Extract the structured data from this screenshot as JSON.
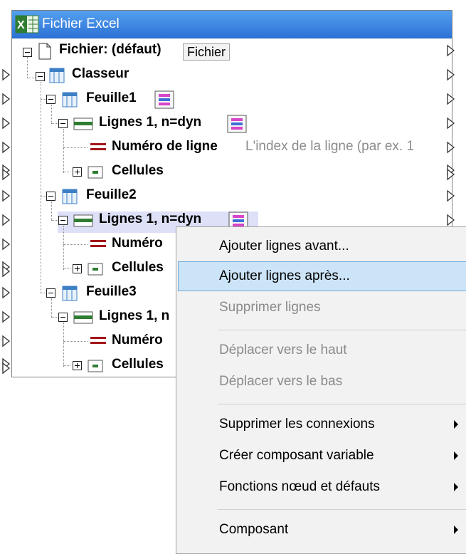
{
  "component": {
    "title": "Fichier Excel",
    "file_label": "Fichier: (défaut)",
    "file_button": "Fichier",
    "nodes": {
      "workbook": "Classeur",
      "sheet1": "Feuille1",
      "rows1": "Lignes 1, n=dyn",
      "rownum1": "Numéro de ligne",
      "rownum1_desc": "L'index de la ligne (par ex. 1",
      "cells1": "Cellules",
      "sheet2": "Feuille2",
      "rows2": "Lignes 1, n=dyn",
      "rownum2": "Numéro",
      "cells2": "Cellules",
      "sheet3": "Feuille3",
      "rows3": "Lignes 1, n",
      "rownum3": "Numéro",
      "cells3": "Cellules"
    }
  },
  "context_menu": {
    "items": [
      {
        "label": "Ajouter lignes avant...",
        "enabled": true
      },
      {
        "label": "Ajouter lignes après...",
        "enabled": true,
        "highlighted": true
      },
      {
        "label": "Supprimer lignes",
        "enabled": false
      },
      {
        "label": "Déplacer vers le haut",
        "enabled": false
      },
      {
        "label": "Déplacer vers le bas",
        "enabled": false
      },
      {
        "label": "Supprimer les connexions",
        "enabled": true,
        "submenu": true
      },
      {
        "label": "Créer composant variable",
        "enabled": true,
        "submenu": true
      },
      {
        "label": "Fonctions nœud et défauts",
        "enabled": true,
        "submenu": true
      },
      {
        "label": "Composant",
        "enabled": true,
        "submenu": true
      }
    ]
  },
  "colors": {
    "title_bar": "#3a82e0",
    "selection_highlight": "#dde0f7",
    "menu_hover": "#cce4f7",
    "menu_background": "#f2f2f2",
    "disabled_text": "#8a8a8a"
  }
}
